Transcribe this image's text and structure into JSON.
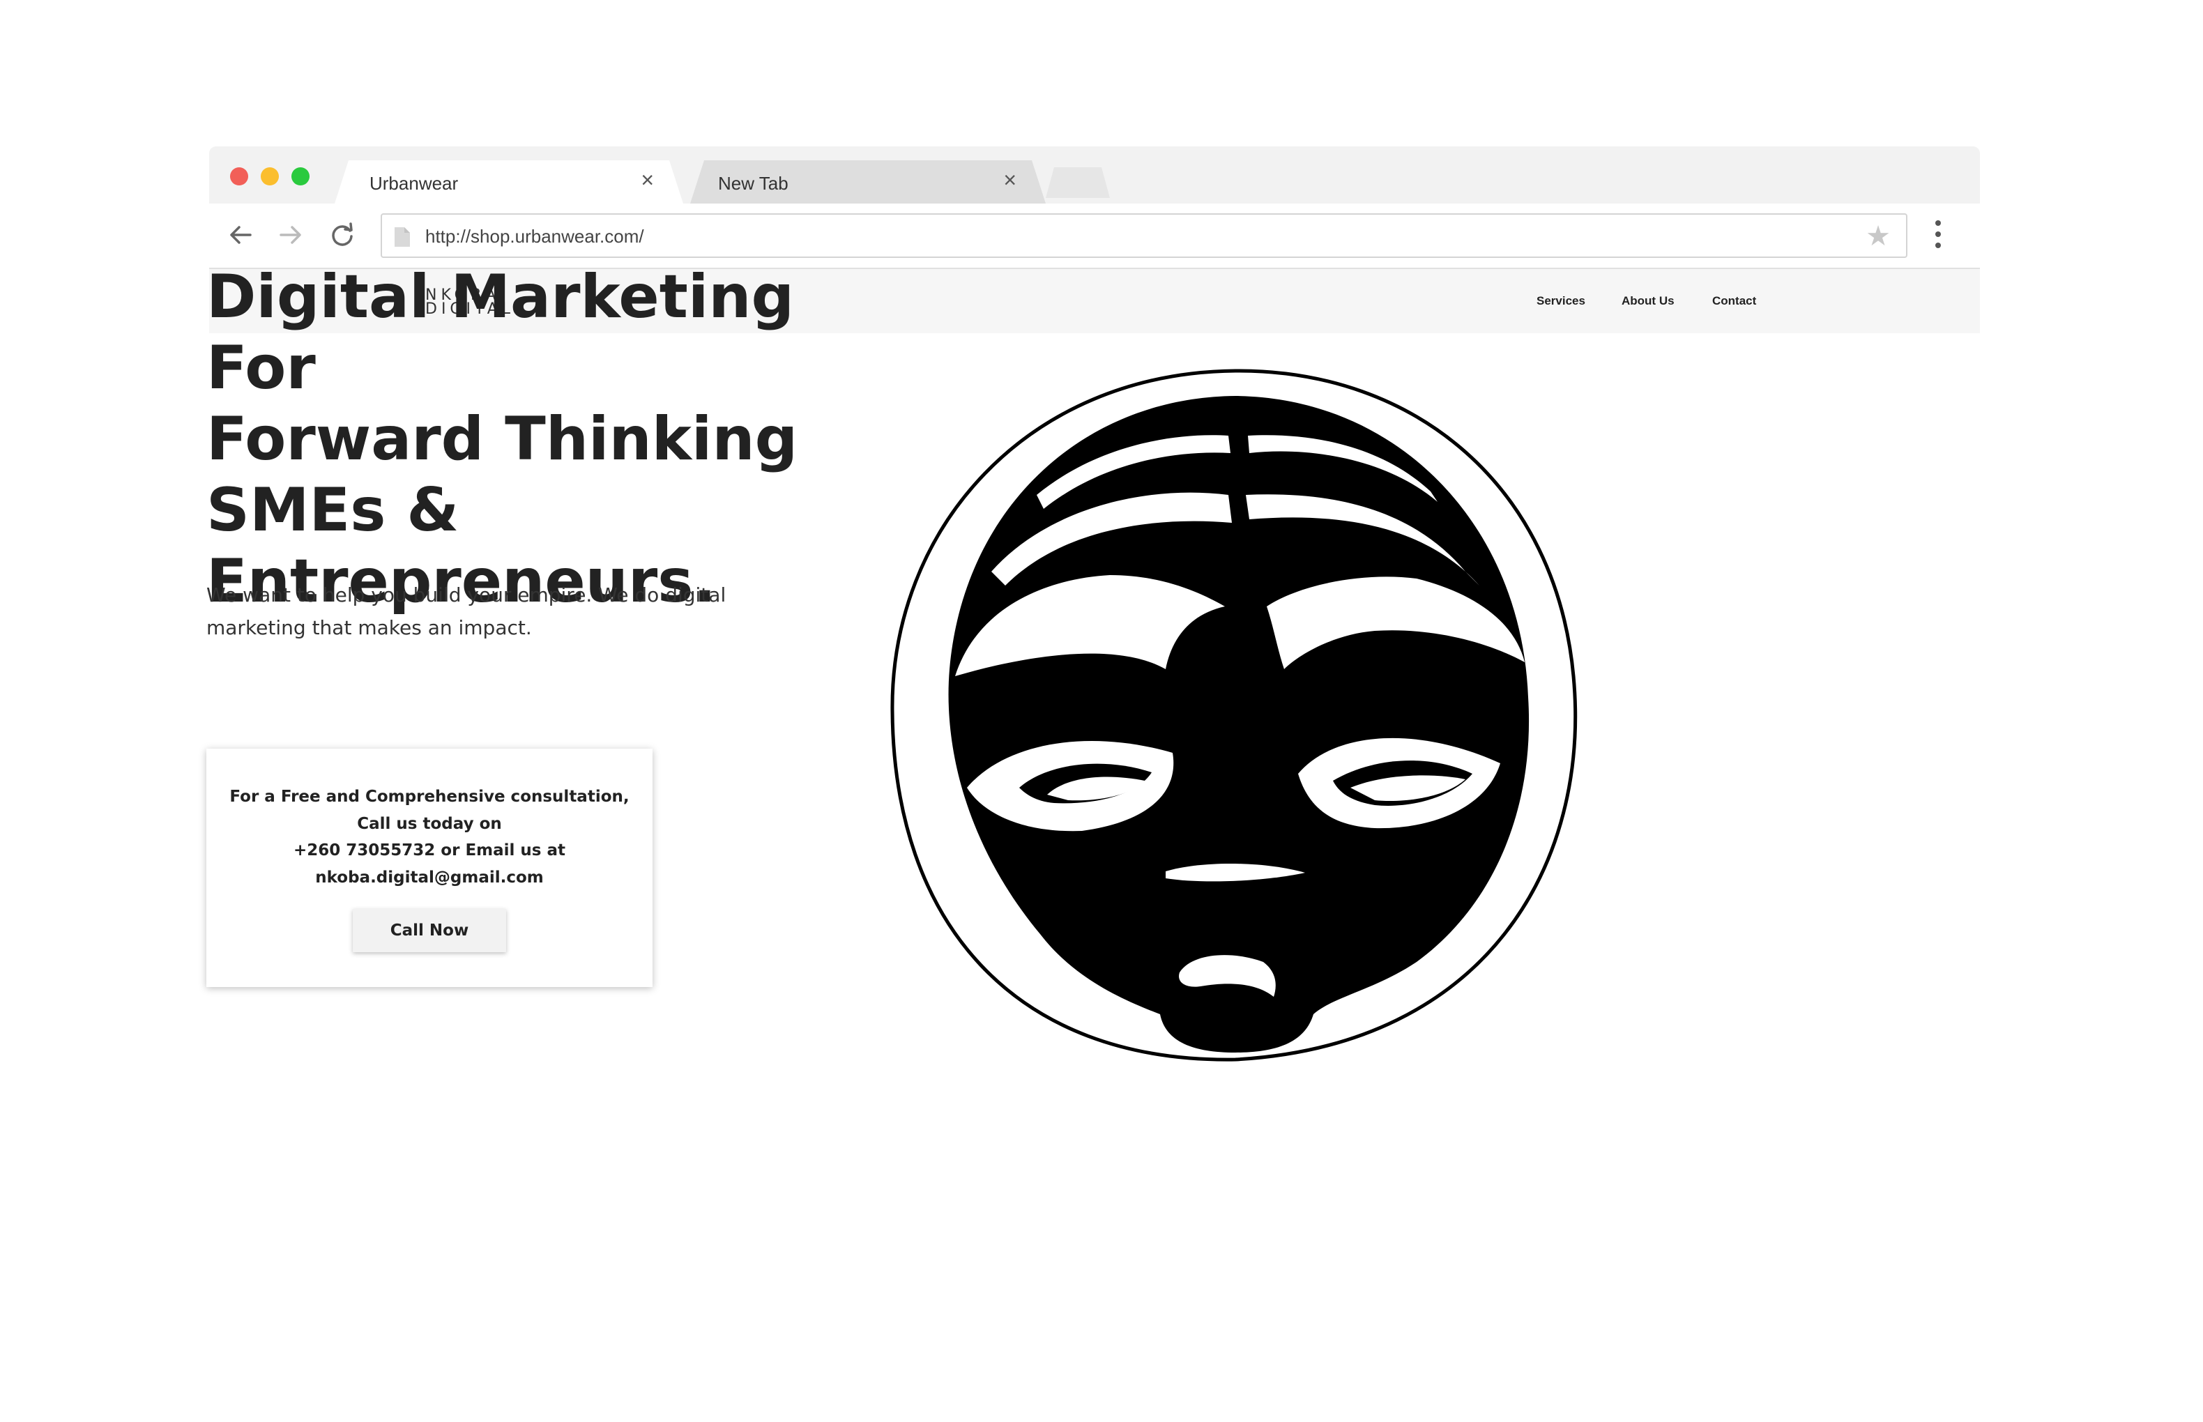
{
  "browser": {
    "tabs": [
      {
        "label": "Urbanwear",
        "active": true
      },
      {
        "label": "New Tab",
        "active": false
      }
    ],
    "address_bar": {
      "url": "http://shop.urbanwear.com/"
    },
    "traffic_colors": {
      "close": "#f25f58",
      "minimize": "#fbbe2e",
      "maximize": "#2aca3e"
    }
  },
  "site": {
    "logo_line1": "NKOBA",
    "logo_line2": "DIGITAL.",
    "nav": [
      "Services",
      "About Us",
      "Contact"
    ]
  },
  "hero": {
    "title": "Digital Marketing For\nForward Thinking\nSMEs &\nEntrepreneurs.",
    "subtitle_line1": "We want to help you build your empire. We do digital",
    "subtitle_line2": "marketing that makes an impact."
  },
  "consult_card": {
    "line1": "For a Free and Comprehensive consultation,",
    "line2": "Call us today on",
    "line3": "+260 73055732 or Email us at",
    "line4": "nkoba.digital@gmail.com",
    "button_label": "Call Now"
  },
  "illustration": {
    "subject": "african-mask",
    "colors": {
      "fill": "#000000",
      "ring": "#000000",
      "background": "#ffffff"
    }
  }
}
